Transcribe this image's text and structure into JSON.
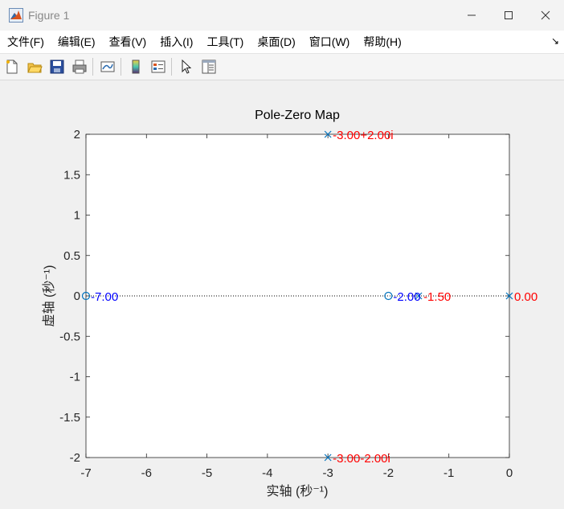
{
  "window": {
    "title": "Figure 1"
  },
  "menu": {
    "items": [
      "文件(F)",
      "编辑(E)",
      "查看(V)",
      "插入(I)",
      "工具(T)",
      "桌面(D)",
      "窗口(W)",
      "帮助(H)"
    ],
    "overflow_icon": "menu-overflow-arrow"
  },
  "toolbar": {
    "icons": [
      "new-figure-icon",
      "open-file-icon",
      "save-icon",
      "print-icon",
      "link-plot-icon",
      "colorbar-icon",
      "legend-icon",
      "select-pointer-icon",
      "property-editor-icon"
    ]
  },
  "chart_data": {
    "type": "scatter",
    "title": "Pole-Zero Map",
    "xlabel": "实轴 (秒⁻¹)",
    "ylabel": "虚轴 (秒⁻¹)",
    "xlim": [
      -7,
      0
    ],
    "ylim": [
      -2,
      2
    ],
    "xticks": [
      -7,
      -6,
      -5,
      -4,
      -3,
      -2,
      -1,
      0
    ],
    "yticks": [
      -2,
      -1.5,
      -1,
      -0.5,
      0,
      0.5,
      1,
      1.5,
      2
    ],
    "xtick_labels": [
      "-7",
      "-6",
      "-5",
      "-4",
      "-3",
      "-2",
      "-1",
      "0"
    ],
    "ytick_labels": [
      "-2",
      "-1.5",
      "-1",
      "-0.5",
      "0",
      "0.5",
      "1",
      "1.5",
      "2"
    ],
    "grid": false,
    "zero_line": true,
    "series": [
      {
        "marker": "x",
        "color": "#0072bd",
        "label_color": "#ff0000",
        "points": [
          {
            "x": -3,
            "y": 2,
            "label": "-3.00+2.00i"
          },
          {
            "x": -3,
            "y": -2,
            "label": "-3.00-2.00i"
          },
          {
            "x": -1.5,
            "y": 0,
            "label": "-1.50"
          },
          {
            "x": 0,
            "y": 0,
            "label": "0.00"
          }
        ]
      },
      {
        "marker": "o",
        "color": "#0072bd",
        "label_color": "#0000ff",
        "points": [
          {
            "x": -7,
            "y": 0,
            "label": "-7.00"
          },
          {
            "x": -2,
            "y": 0,
            "label": "-2.00"
          }
        ]
      }
    ]
  }
}
